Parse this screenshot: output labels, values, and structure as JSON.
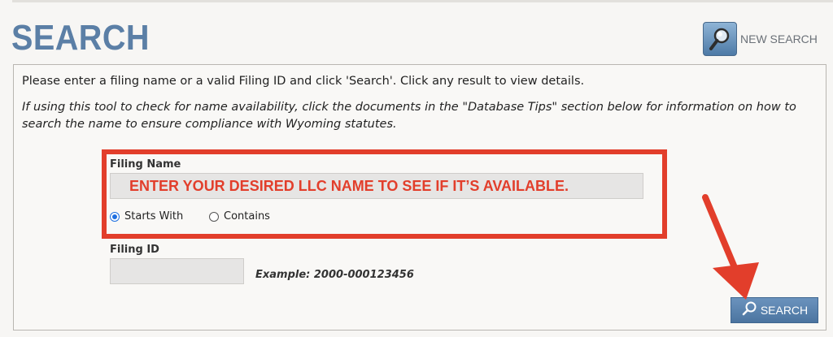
{
  "header": {
    "title": "SEARCH",
    "new_search_label": "NEW SEARCH"
  },
  "instructions": {
    "intro": "Please enter a filing name or a valid Filing ID and click 'Search'. Click any result to view details.",
    "note": "If using this tool to check for name availability, click the documents in the \"Database Tips\" section below for information on how to search the name to ensure compliance with Wyoming statutes."
  },
  "filing_name": {
    "label": "Filing Name",
    "value": "ENTER YOUR DESIRED LLC NAME TO SEE IF IT’S AVAILABLE.",
    "options": [
      {
        "label": "Starts With",
        "checked": true
      },
      {
        "label": "Contains",
        "checked": false
      }
    ]
  },
  "filing_id": {
    "label": "Filing ID",
    "value": "",
    "example": "Example: 2000-000123456"
  },
  "actions": {
    "search_label": "SEARCH"
  },
  "colors": {
    "title": "#5b7fa6",
    "highlight": "#e23e2b",
    "button": "#5b83ae",
    "radio_selected": "#1e6fe0"
  },
  "icons": [
    "magnifier-icon",
    "search-icon"
  ]
}
